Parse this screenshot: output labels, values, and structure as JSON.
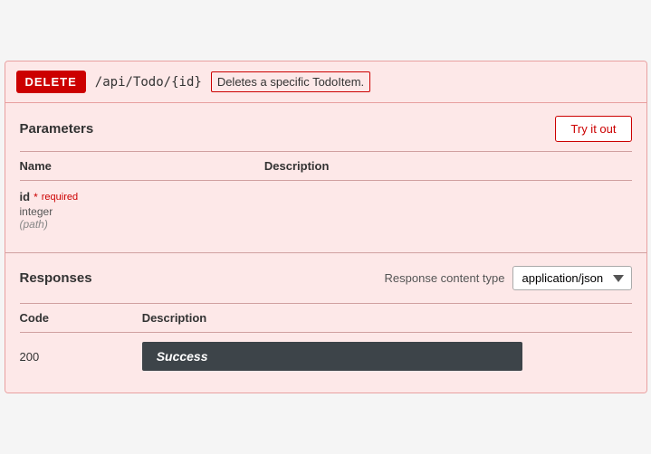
{
  "header": {
    "method": "DELETE",
    "path": "/api/Todo/{id}",
    "description": "Deletes a specific TodoItem."
  },
  "parameters": {
    "section_title": "Parameters",
    "try_button_label": "Try it out",
    "col_name": "Name",
    "col_description": "Description",
    "items": [
      {
        "name": "id",
        "required": true,
        "required_label": "required",
        "type": "integer",
        "location": "(path)"
      }
    ]
  },
  "responses": {
    "section_title": "Responses",
    "content_type_label": "Response content type",
    "content_type_value": "application/json",
    "col_code": "Code",
    "col_description": "Description",
    "items": [
      {
        "code": "200",
        "description": "Success"
      }
    ]
  }
}
